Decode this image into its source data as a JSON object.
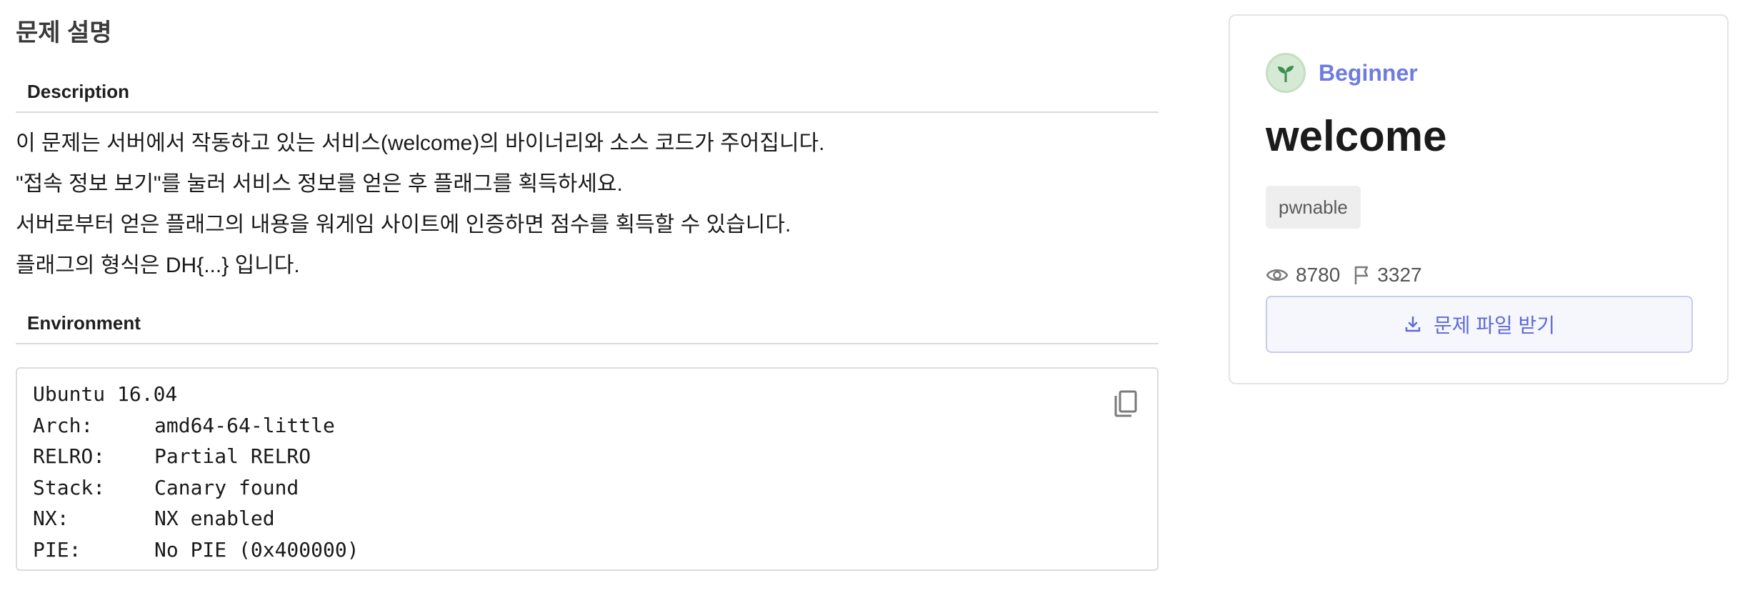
{
  "page_title": "문제 설명",
  "description": {
    "heading": "Description",
    "lines": [
      "이 문제는 서버에서 작동하고 있는 서비스(welcome)의 바이너리와 소스 코드가 주어집니다.",
      "\"접속 정보 보기\"를 눌러 서비스 정보를 얻은 후 플래그를 획득하세요.",
      "서버로부터 얻은 플래그의 내용을 워게임 사이트에 인증하면 점수를 획득할 수 있습니다.",
      "플래그의 형식은 DH{...} 입니다."
    ]
  },
  "environment": {
    "heading": "Environment",
    "title_line": "Ubuntu 16.04",
    "rows": [
      {
        "key": "Arch:",
        "value": "amd64-64-little"
      },
      {
        "key": "RELRO:",
        "value": "Partial RELRO"
      },
      {
        "key": "Stack:",
        "value": "Canary found"
      },
      {
        "key": "NX:",
        "value": "NX enabled"
      },
      {
        "key": "PIE:",
        "value": "No PIE (0x400000)"
      }
    ],
    "copy_icon": "copy-icon"
  },
  "card": {
    "level": "Beginner",
    "level_icon": "sprout-icon",
    "title": "welcome",
    "tag": "pwnable",
    "views": "8780",
    "solves": "3327",
    "views_icon": "eye-icon",
    "solves_icon": "flag-icon",
    "download_label": "문제 파일 받기",
    "download_icon": "download-icon"
  },
  "colors": {
    "accent": "#6e7be0",
    "level_badge_bg": "#d6e9d4",
    "level_sprout": "#3c8f52",
    "download_bg": "#f6f6fd",
    "download_border": "#c6cbf1"
  }
}
